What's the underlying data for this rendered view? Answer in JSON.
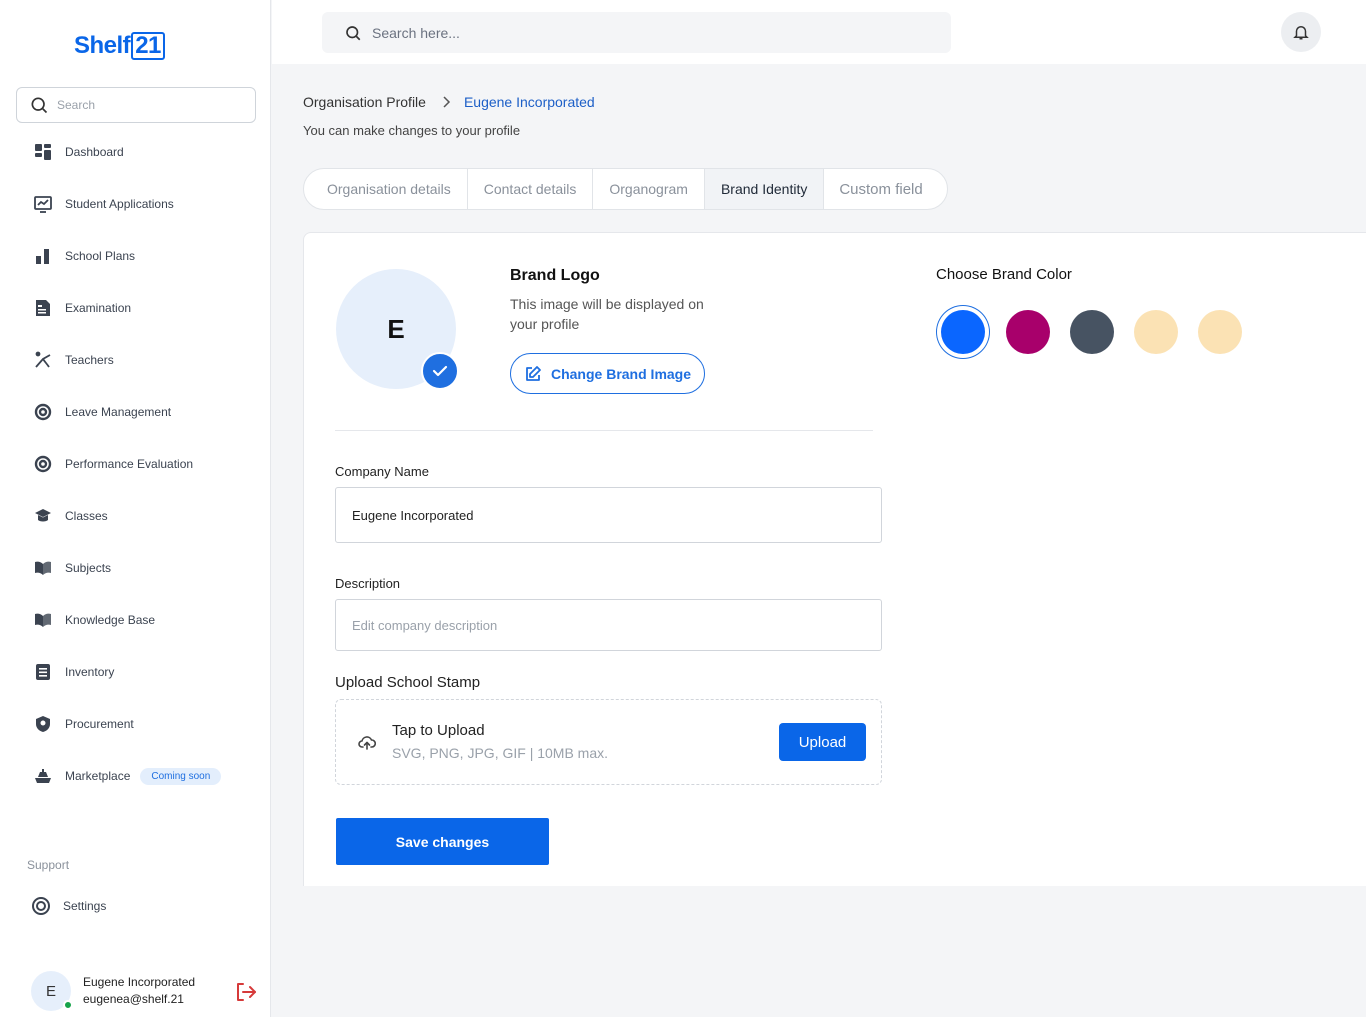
{
  "sidebar": {
    "logo_text": "Shelf",
    "logo_box": "21",
    "search_placeholder": "Search",
    "items": [
      {
        "label": "Dashboard",
        "icon": "dashboard-icon"
      },
      {
        "label": "Student Applications",
        "icon": "chart-icon"
      },
      {
        "label": "School Plans",
        "icon": "bar-icon"
      },
      {
        "label": "Examination",
        "icon": "exam-icon"
      },
      {
        "label": "Teachers",
        "icon": "teacher-icon"
      },
      {
        "label": "Leave Management",
        "icon": "lifebuoy-icon"
      },
      {
        "label": "Performance Evaluation",
        "icon": "lifebuoy-icon"
      },
      {
        "label": "Classes",
        "icon": "graduation-icon"
      },
      {
        "label": "Subjects",
        "icon": "book-icon"
      },
      {
        "label": "Knowledge Base",
        "icon": "book-icon"
      },
      {
        "label": "Inventory",
        "icon": "list-icon"
      },
      {
        "label": "Procurement",
        "icon": "shield-icon"
      },
      {
        "label": "Marketplace",
        "icon": "ship-icon",
        "badge": "Coming soon"
      }
    ],
    "support_label": "Support",
    "settings_label": "Settings",
    "user": {
      "initial": "E",
      "name": "Eugene Incorporated",
      "email": "eugenea@shelf.21"
    }
  },
  "topbar": {
    "search_placeholder": "Search here..."
  },
  "breadcrumb": {
    "parent": "Organisation Profile",
    "current": "Eugene Incorporated"
  },
  "subtitle": "You can make changes to your profile",
  "tabs": [
    "Organisation details",
    "Contact details",
    "Organogram",
    "Brand Identity",
    "Custom field"
  ],
  "active_tab": "Brand Identity",
  "brand": {
    "initial": "E",
    "title": "Brand Logo",
    "description": "This image will be displayed on your profile",
    "change_button": "Change Brand Image"
  },
  "colors": {
    "title": "Choose Brand Color",
    "swatches": [
      "#0a66ff",
      "#a8006b",
      "#475362",
      "#fbe2b4",
      "#fbe2b4"
    ],
    "selected_index": 0
  },
  "form": {
    "company_name_label": "Company Name",
    "company_name_value": "Eugene Incorporated",
    "description_label": "Description",
    "description_placeholder": "Edit company description",
    "stamp_label": "Upload School Stamp",
    "upload_title": "Tap to Upload",
    "upload_hint": "SVG, PNG, JPG, GIF | 10MB max.",
    "upload_button": "Upload",
    "save_button": "Save changes"
  }
}
